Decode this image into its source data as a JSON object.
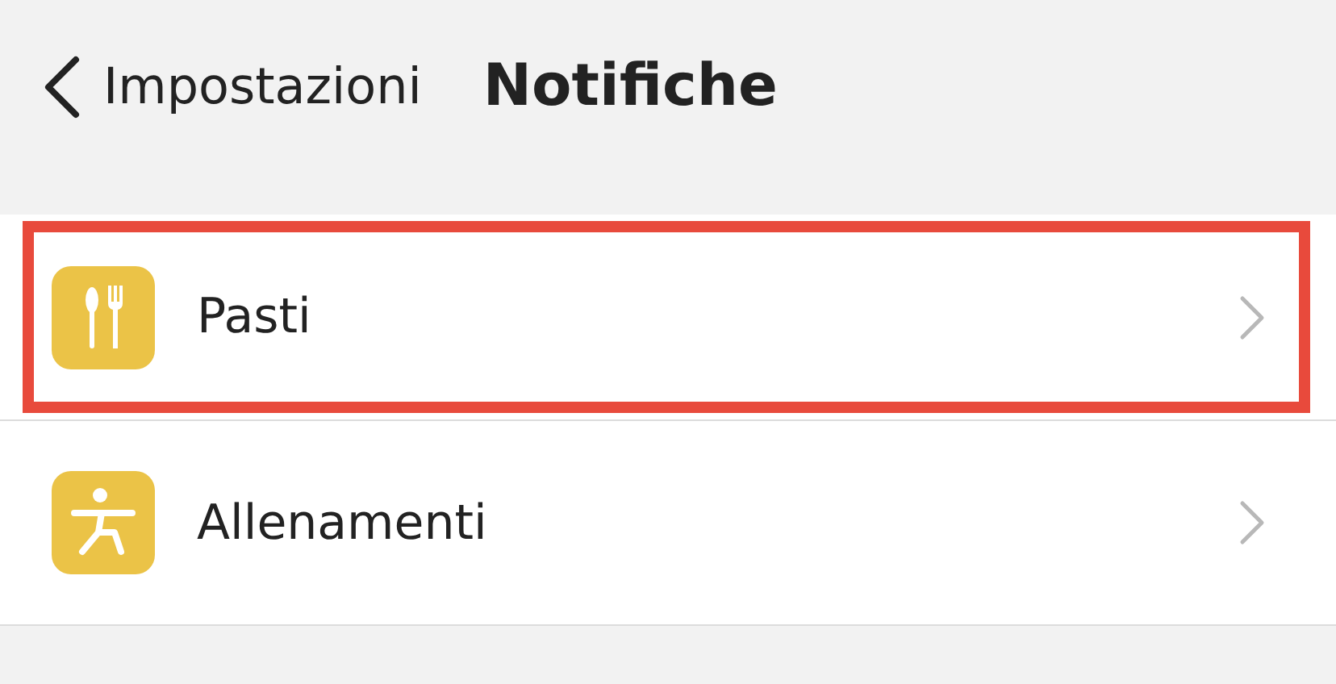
{
  "nav_bar": {
    "back_label": "Impostazioni",
    "title": "Notifiche"
  },
  "items": [
    {
      "label": "Pasti",
      "kind": "meals",
      "highlighted": true
    },
    {
      "label": "Allenamenti",
      "kind": "workouts",
      "highlighted": false
    }
  ]
}
